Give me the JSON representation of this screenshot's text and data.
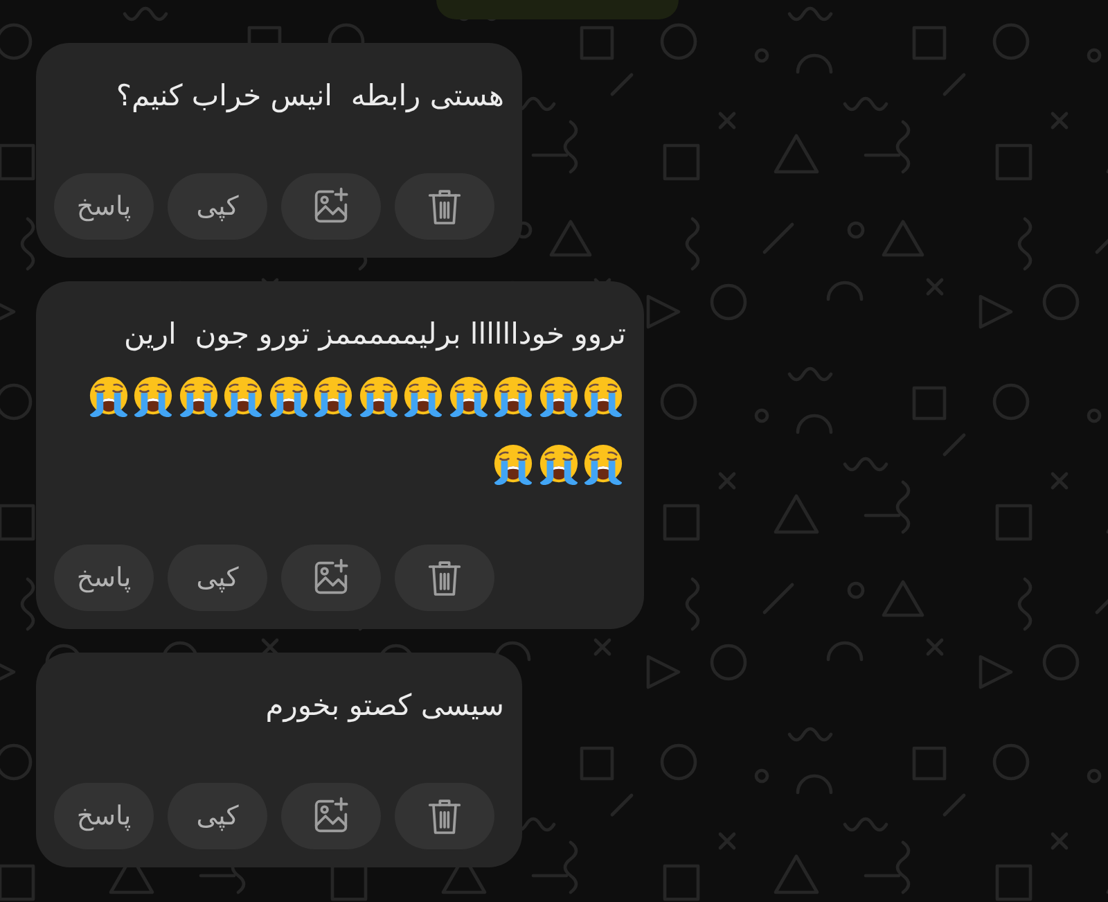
{
  "messages": [
    {
      "kind": "outgoing"
    },
    {
      "kind": "incoming",
      "text": "هستی رابطه  انیس خراب کنیم؟",
      "actions": [
        {
          "kind": "delete"
        },
        {
          "kind": "add-image"
        },
        {
          "kind": "copy",
          "label": "کپی"
        },
        {
          "kind": "reply",
          "label": "پاسخ"
        }
      ]
    },
    {
      "kind": "incoming",
      "text": "تروو خوداااااا برلیمممممز تورو جون  ارین",
      "emojis": [
        {
          "kind": "loudly-crying"
        },
        {
          "kind": "loudly-crying"
        },
        {
          "kind": "loudly-crying"
        },
        {
          "kind": "loudly-crying"
        },
        {
          "kind": "loudly-crying"
        },
        {
          "kind": "loudly-crying"
        },
        {
          "kind": "loudly-crying"
        },
        {
          "kind": "loudly-crying"
        },
        {
          "kind": "loudly-crying"
        },
        {
          "kind": "loudly-crying"
        },
        {
          "kind": "loudly-crying"
        },
        {
          "kind": "loudly-crying"
        },
        {
          "kind": "loudly-crying"
        },
        {
          "kind": "loudly-crying"
        },
        {
          "kind": "loudly-crying"
        }
      ],
      "actions": [
        {
          "kind": "delete"
        },
        {
          "kind": "add-image"
        },
        {
          "kind": "copy",
          "label": "کپی"
        },
        {
          "kind": "reply",
          "label": "پاسخ"
        }
      ]
    },
    {
      "kind": "incoming",
      "text": "سیسی کصتو بخورم",
      "actions": [
        {
          "kind": "delete"
        },
        {
          "kind": "add-image"
        },
        {
          "kind": "copy",
          "label": "کپی"
        },
        {
          "kind": "reply",
          "label": "پاسخ"
        }
      ]
    }
  ]
}
